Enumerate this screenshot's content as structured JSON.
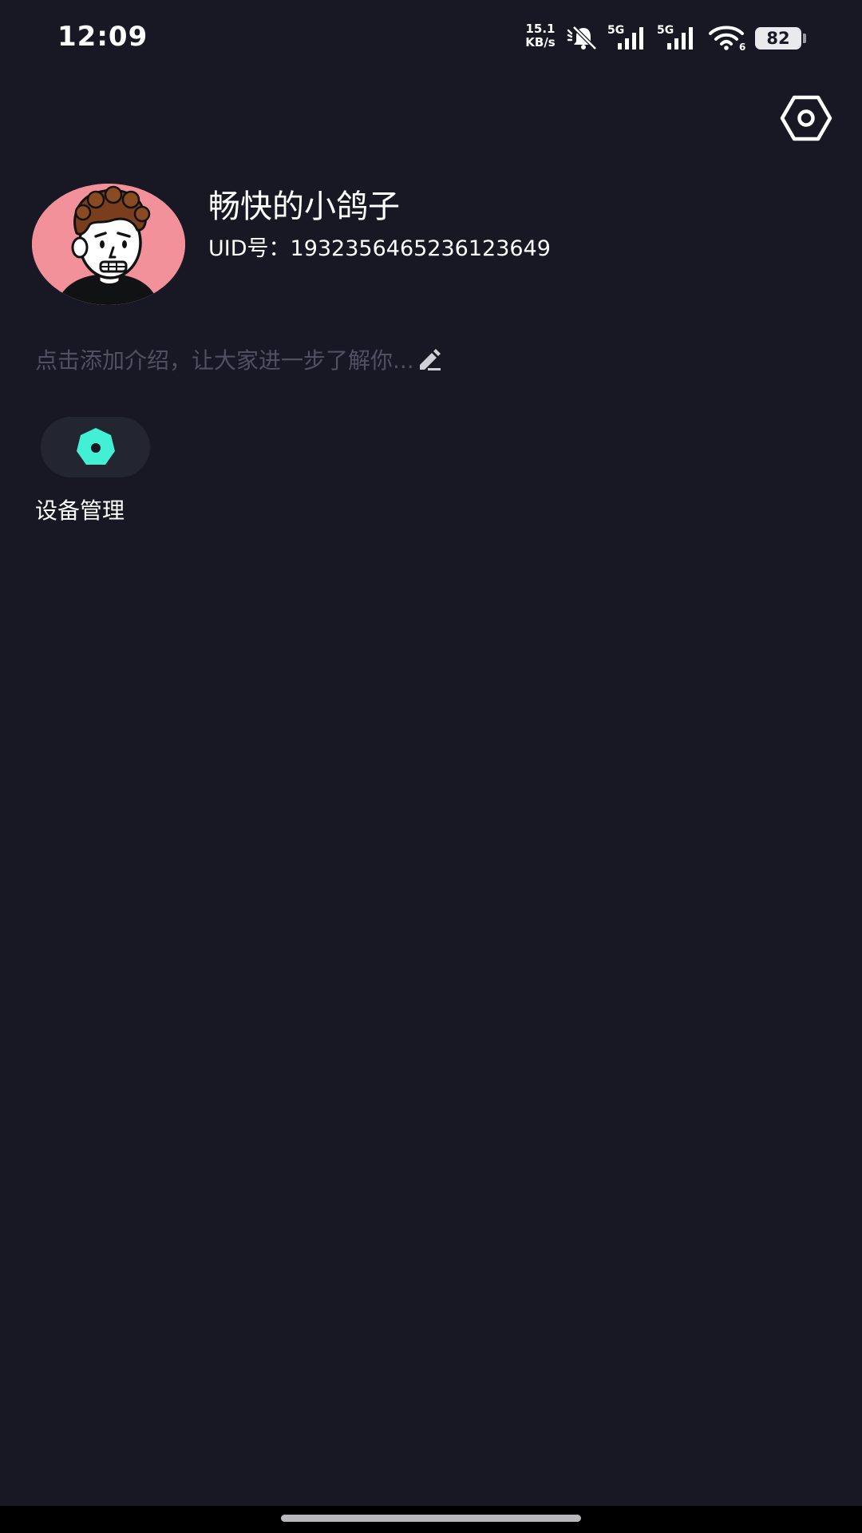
{
  "status_bar": {
    "time": "12:09",
    "net_speed_value": "15.1",
    "net_speed_unit": "KB/s",
    "sim1_label": "5G",
    "sim2_label": "5G",
    "wifi_label": "6",
    "battery_level": "82",
    "icons": [
      "mute-bell-icon",
      "signal-5g-icon",
      "signal-5g-icon",
      "wifi-icon",
      "battery-icon"
    ]
  },
  "header": {
    "settings_icon": "hex-settings-icon"
  },
  "profile": {
    "username": "畅快的小鸽子",
    "uid": "UID号：1932356465236123649",
    "intro_placeholder": "点击添加介绍，让大家进一步了解你...",
    "edit_icon": "pencil-icon"
  },
  "shortcuts": [
    {
      "label": "设备管理",
      "icon": "hexagon-device-icon",
      "accent": "#43f0d4"
    }
  ],
  "colors": {
    "background": "#171824",
    "accent": "#43f0d4",
    "muted_text": "#4f5160",
    "avatar_bg": "#f3919a"
  }
}
